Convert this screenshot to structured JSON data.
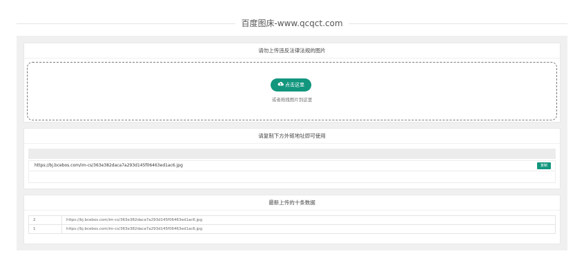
{
  "header": {
    "title": "百度图床-www.qcqct.com"
  },
  "upload": {
    "heading": "请勿上传违反法律法规的图片",
    "button_label": "点击这里",
    "hint": "或者拖拽图片到这里"
  },
  "result": {
    "heading": "请复制下方外链地址即可使用",
    "url": "https://bj.bcebos.com/im-cs/363e382daca7a293d145f06463ed1ac6.jpg",
    "copy_label": "复制"
  },
  "recent": {
    "heading": "最新上传的十条数据",
    "rows": [
      {
        "id": "2",
        "url": "https://bj.bcebos.com/im-cs/363e382daca7a293d145f06463ed1ac6.jpg"
      },
      {
        "id": "1",
        "url": "https://bj.bcebos.com/im-cs/363e382daca7a293d145f06463ed1ac6.jpg"
      }
    ]
  },
  "colors": {
    "accent": "#12967e",
    "panel_bg": "#f0f0f0"
  }
}
